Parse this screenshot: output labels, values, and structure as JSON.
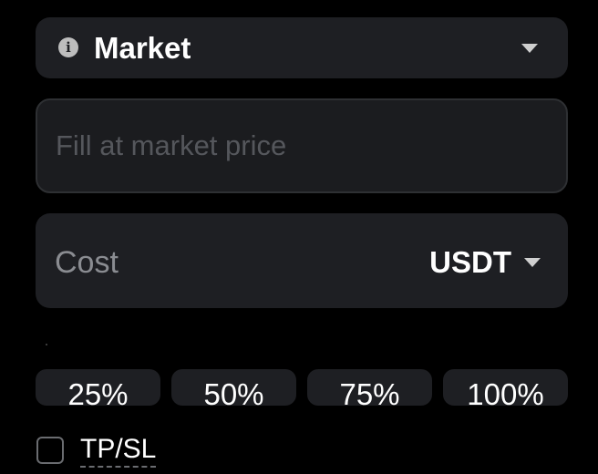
{
  "order_type": {
    "label": "Market",
    "info_icon": "info-icon",
    "dropdown_icon": "caret-down-icon"
  },
  "price": {
    "placeholder": "Fill at market price"
  },
  "cost": {
    "label": "Cost",
    "currency": "USDT",
    "dropdown_icon": "caret-down-icon"
  },
  "percent_buttons": [
    "25%",
    "50%",
    "75%",
    "100%"
  ],
  "tpsl": {
    "label": "TP/SL",
    "checked": false
  },
  "colors": {
    "background": "#000000",
    "field": "#1e1f23",
    "placeholder": "#55575c",
    "text": "#ffffff",
    "muted": "#8a8c91"
  }
}
